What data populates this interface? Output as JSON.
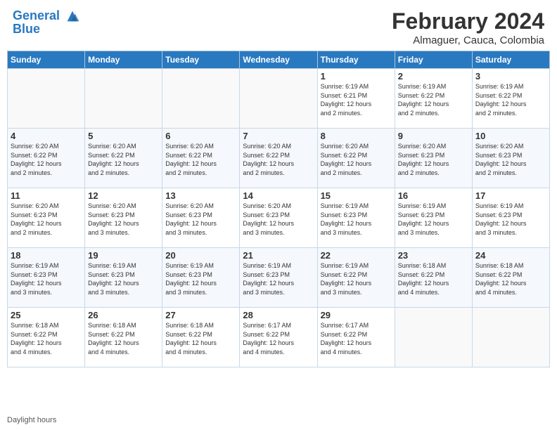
{
  "header": {
    "logo_line1": "General",
    "logo_line2": "Blue",
    "main_title": "February 2024",
    "subtitle": "Almaguer, Cauca, Colombia"
  },
  "days_of_week": [
    "Sunday",
    "Monday",
    "Tuesday",
    "Wednesday",
    "Thursday",
    "Friday",
    "Saturday"
  ],
  "weeks": [
    [
      {
        "day": "",
        "info": ""
      },
      {
        "day": "",
        "info": ""
      },
      {
        "day": "",
        "info": ""
      },
      {
        "day": "",
        "info": ""
      },
      {
        "day": "1",
        "info": "Sunrise: 6:19 AM\nSunset: 6:21 PM\nDaylight: 12 hours\nand 2 minutes."
      },
      {
        "day": "2",
        "info": "Sunrise: 6:19 AM\nSunset: 6:22 PM\nDaylight: 12 hours\nand 2 minutes."
      },
      {
        "day": "3",
        "info": "Sunrise: 6:19 AM\nSunset: 6:22 PM\nDaylight: 12 hours\nand 2 minutes."
      }
    ],
    [
      {
        "day": "4",
        "info": "Sunrise: 6:20 AM\nSunset: 6:22 PM\nDaylight: 12 hours\nand 2 minutes."
      },
      {
        "day": "5",
        "info": "Sunrise: 6:20 AM\nSunset: 6:22 PM\nDaylight: 12 hours\nand 2 minutes."
      },
      {
        "day": "6",
        "info": "Sunrise: 6:20 AM\nSunset: 6:22 PM\nDaylight: 12 hours\nand 2 minutes."
      },
      {
        "day": "7",
        "info": "Sunrise: 6:20 AM\nSunset: 6:22 PM\nDaylight: 12 hours\nand 2 minutes."
      },
      {
        "day": "8",
        "info": "Sunrise: 6:20 AM\nSunset: 6:22 PM\nDaylight: 12 hours\nand 2 minutes."
      },
      {
        "day": "9",
        "info": "Sunrise: 6:20 AM\nSunset: 6:23 PM\nDaylight: 12 hours\nand 2 minutes."
      },
      {
        "day": "10",
        "info": "Sunrise: 6:20 AM\nSunset: 6:23 PM\nDaylight: 12 hours\nand 2 minutes."
      }
    ],
    [
      {
        "day": "11",
        "info": "Sunrise: 6:20 AM\nSunset: 6:23 PM\nDaylight: 12 hours\nand 2 minutes."
      },
      {
        "day": "12",
        "info": "Sunrise: 6:20 AM\nSunset: 6:23 PM\nDaylight: 12 hours\nand 3 minutes."
      },
      {
        "day": "13",
        "info": "Sunrise: 6:20 AM\nSunset: 6:23 PM\nDaylight: 12 hours\nand 3 minutes."
      },
      {
        "day": "14",
        "info": "Sunrise: 6:20 AM\nSunset: 6:23 PM\nDaylight: 12 hours\nand 3 minutes."
      },
      {
        "day": "15",
        "info": "Sunrise: 6:19 AM\nSunset: 6:23 PM\nDaylight: 12 hours\nand 3 minutes."
      },
      {
        "day": "16",
        "info": "Sunrise: 6:19 AM\nSunset: 6:23 PM\nDaylight: 12 hours\nand 3 minutes."
      },
      {
        "day": "17",
        "info": "Sunrise: 6:19 AM\nSunset: 6:23 PM\nDaylight: 12 hours\nand 3 minutes."
      }
    ],
    [
      {
        "day": "18",
        "info": "Sunrise: 6:19 AM\nSunset: 6:23 PM\nDaylight: 12 hours\nand 3 minutes."
      },
      {
        "day": "19",
        "info": "Sunrise: 6:19 AM\nSunset: 6:23 PM\nDaylight: 12 hours\nand 3 minutes."
      },
      {
        "day": "20",
        "info": "Sunrise: 6:19 AM\nSunset: 6:23 PM\nDaylight: 12 hours\nand 3 minutes."
      },
      {
        "day": "21",
        "info": "Sunrise: 6:19 AM\nSunset: 6:23 PM\nDaylight: 12 hours\nand 3 minutes."
      },
      {
        "day": "22",
        "info": "Sunrise: 6:19 AM\nSunset: 6:22 PM\nDaylight: 12 hours\nand 3 minutes."
      },
      {
        "day": "23",
        "info": "Sunrise: 6:18 AM\nSunset: 6:22 PM\nDaylight: 12 hours\nand 4 minutes."
      },
      {
        "day": "24",
        "info": "Sunrise: 6:18 AM\nSunset: 6:22 PM\nDaylight: 12 hours\nand 4 minutes."
      }
    ],
    [
      {
        "day": "25",
        "info": "Sunrise: 6:18 AM\nSunset: 6:22 PM\nDaylight: 12 hours\nand 4 minutes."
      },
      {
        "day": "26",
        "info": "Sunrise: 6:18 AM\nSunset: 6:22 PM\nDaylight: 12 hours\nand 4 minutes."
      },
      {
        "day": "27",
        "info": "Sunrise: 6:18 AM\nSunset: 6:22 PM\nDaylight: 12 hours\nand 4 minutes."
      },
      {
        "day": "28",
        "info": "Sunrise: 6:17 AM\nSunset: 6:22 PM\nDaylight: 12 hours\nand 4 minutes."
      },
      {
        "day": "29",
        "info": "Sunrise: 6:17 AM\nSunset: 6:22 PM\nDaylight: 12 hours\nand 4 minutes."
      },
      {
        "day": "",
        "info": ""
      },
      {
        "day": "",
        "info": ""
      }
    ]
  ],
  "legend": "Daylight hours"
}
